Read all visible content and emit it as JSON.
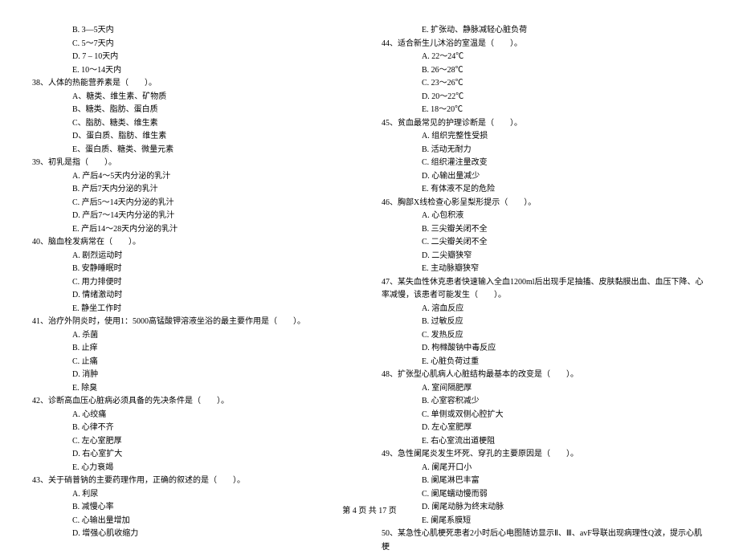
{
  "leftColumn": {
    "preOptions": [
      "B. 3—5天内",
      "C. 5～7天内",
      "D. 7 – 10天内",
      "E. 10～14天内"
    ],
    "questions": [
      {
        "num": "38、",
        "title": "人体的热能营养素是（　　）。",
        "options": [
          "A、糖类、维生素、矿物质",
          "B、糖类、脂肪、蛋白质",
          "C、脂肪、糖类、维生素",
          "D、蛋白质、脂肪、维生素",
          "E、蛋白质、糖类、微量元素"
        ]
      },
      {
        "num": "39、",
        "title": "初乳是指（　　）。",
        "options": [
          "A. 产后4～5天内分泌的乳汁",
          "B. 产后7天内分泌的乳汁",
          "C. 产后5～14天内分泌的乳汁",
          "D. 产后7～14天内分泌的乳汁",
          "E. 产后14～28天内分泌的乳汁"
        ]
      },
      {
        "num": "40、",
        "title": "脑血栓发病常在（　　）。",
        "options": [
          "A. 剧烈运动时",
          "B. 安静睡眠时",
          "C. 用力排便时",
          "D. 情绪激动时",
          "E. 静坐工作时"
        ]
      },
      {
        "num": "41、",
        "title": "治疗外阴炎时，使用1：5000高锰酸钾溶液坐浴的最主要作用是（　　）。",
        "options": [
          "A. 杀菌",
          "B. 止痒",
          "C. 止痛",
          "D. 消肿",
          "E. 除臭"
        ]
      },
      {
        "num": "42、",
        "title": "诊断高血压心脏病必须具备的先决条件是（　　）。",
        "options": [
          "A. 心绞痛",
          "B. 心律不齐",
          "C. 左心室肥厚",
          "D. 右心室扩大",
          "E. 心力衰竭"
        ]
      },
      {
        "num": "43、",
        "title": "关于硝普钠的主要药理作用，正确的叙述的是（　　）。",
        "options": [
          "A. 利尿",
          "B. 减慢心率",
          "C. 心输出量增加",
          "D. 增强心肌收缩力"
        ]
      }
    ]
  },
  "rightColumn": {
    "preOptions": [
      "E. 扩张动、静脉减轻心脏负荷"
    ],
    "questions": [
      {
        "num": "44、",
        "title": "适合新生儿沐浴的室温是（　　）。",
        "options": [
          "A. 22～24℃",
          "B. 26～28℃",
          "C. 23～26℃",
          "D. 20～22℃",
          "E. 18～20℃"
        ]
      },
      {
        "num": "45、",
        "title": "贫血最常见的护理诊断是（　　）。",
        "options": [
          "A. 组织完整性受损",
          "B. 活动无耐力",
          "C. 组织灌注量改变",
          "D. 心输出量减少",
          "E. 有体液不足的危险"
        ]
      },
      {
        "num": "46、",
        "title": "胸部X线检查心影呈梨形提示（　　）。",
        "options": [
          "A. 心包积液",
          "B. 三尖瓣关闭不全",
          "C. 二尖瓣关闭不全",
          "D. 二尖瓣狭窄",
          "E. 主动脉瓣狭窄"
        ]
      },
      {
        "num": "47、",
        "title": "某失血性休克患者快速输入全血1200ml后出现手足抽搐、皮肤黏膜出血、血压下降、心率减慢，该患者可能发生（　　）。",
        "options": [
          "A. 溶血反应",
          "B. 过敏反应",
          "C. 发热反应",
          "D. 枸橼酸钠中毒反应",
          "E. 心脏负荷过重"
        ]
      },
      {
        "num": "48、",
        "title": "扩张型心肌病人心脏结构最基本的改变是（　　）。",
        "options": [
          "A. 室间隔肥厚",
          "B. 心室容积减少",
          "C. 单侧或双侧心腔扩大",
          "D. 左心室肥厚",
          "E. 右心室流出道梗阻"
        ]
      },
      {
        "num": "49、",
        "title": "急性阑尾炎发生坏死、穿孔的主要原因是（　　）。",
        "options": [
          "A. 阑尾开口小",
          "B. 阑尾淋巴丰富",
          "C. 阑尾蠕动慢而弱",
          "D. 阑尾动脉为终末动脉",
          "E. 阑尾系膜短"
        ]
      },
      {
        "num": "50、",
        "title": "某急性心肌梗死患者2小时后心电图随访显示Ⅱ、Ⅲ、avF导联出现病理性Q波，提示心肌梗",
        "options": []
      }
    ]
  },
  "footer": "第 4 页 共 17 页"
}
